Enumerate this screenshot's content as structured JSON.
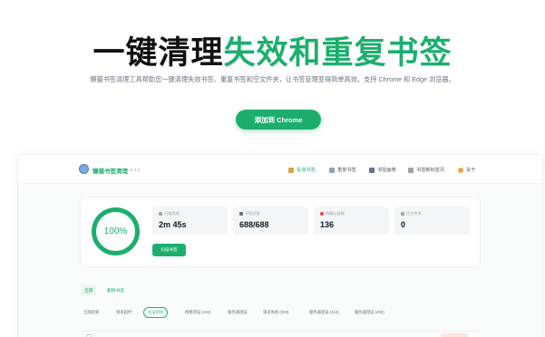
{
  "hero": {
    "title_dark": "一键清理",
    "title_green": "失效和重复书签",
    "subtitle": "懒猫书签清理工具帮助您一键清理失效书签、重复书签和空文件夹，让书签管理变得简单高效。支持 Chrome 和 Edge 浏览器。",
    "cta_label": "添加到 Chrome"
  },
  "app": {
    "name": "懒猫书签清理",
    "version": "v1.4.0",
    "nav": [
      {
        "label": "失效书签",
        "icon": "broom-icon",
        "active": true
      },
      {
        "label": "重复书签",
        "icon": "duplicate-icon",
        "active": false
      },
      {
        "label": "书签画像",
        "icon": "bar-chart-icon",
        "active": false
      },
      {
        "label": "书签新标签页",
        "icon": "new-tab-icon",
        "active": false
      },
      {
        "label": "关于",
        "icon": "cat-icon",
        "active": false
      }
    ],
    "progress": "100%",
    "stats": [
      {
        "label": "扫描用时",
        "value": "2m 45s",
        "icon": "clock-icon",
        "icon_color": "#9ca3af"
      },
      {
        "label": "书签总数",
        "value": "688/688",
        "icon": "bookmark-icon",
        "icon_color": "#6b7280"
      },
      {
        "label": "待确认链接",
        "value": "136",
        "icon": "heart-icon",
        "icon_color": "#ef4444"
      },
      {
        "label": "空文件夹",
        "value": "0",
        "icon": "folder-icon",
        "icon_color": "#9ca3af"
      }
    ],
    "scan_button": "扫描书签",
    "sub_tabs": [
      "全部",
      "删除书签"
    ],
    "filters": [
      "全部结果",
      "请求超时",
      "无法访问",
      "网络错误 (102)",
      "服务器错误",
      "请求失败 (403)",
      "服务器错误 (418)",
      "服务器错误 (400)"
    ]
  },
  "colors": {
    "accent": "#1dae6e"
  }
}
